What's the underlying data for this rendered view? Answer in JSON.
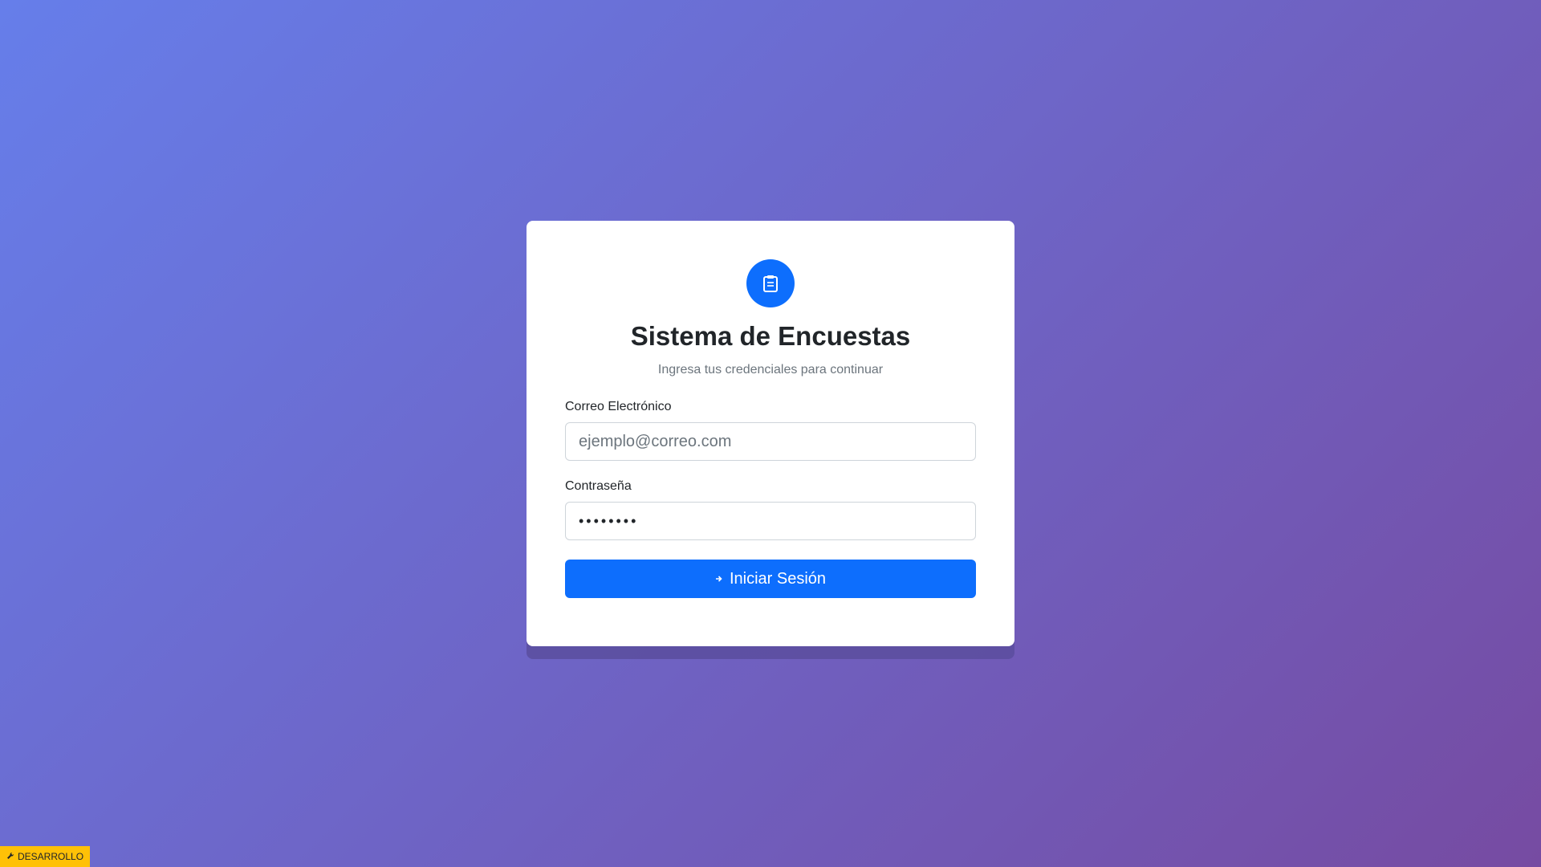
{
  "login": {
    "logo_icon": "clipboard-icon",
    "title": "Sistema de Encuestas",
    "subtitle": "Ingresa tus credenciales para continuar",
    "email_label": "Correo Electrónico",
    "email_placeholder": "ejemplo@correo.com",
    "email_value": "",
    "password_label": "Contraseña",
    "password_value": "••••••••",
    "submit_label": "Iniciar Sesión",
    "submit_icon": "login-icon"
  },
  "env_badge": {
    "icon": "wrench-icon",
    "label": "DESARROLLO"
  },
  "colors": {
    "background_start": "#667eea",
    "background_end": "#764ba2",
    "primary": "#0d6efd",
    "badge": "#ffc107"
  }
}
